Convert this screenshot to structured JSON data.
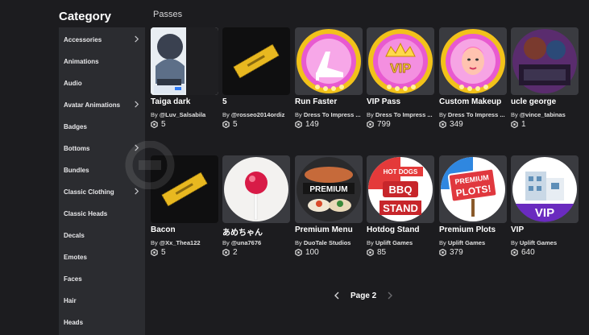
{
  "sidebar": {
    "title": "Category",
    "items": [
      {
        "label": "Accessories",
        "chevron": true
      },
      {
        "label": "Animations",
        "chevron": false
      },
      {
        "label": "Audio",
        "chevron": false
      },
      {
        "label": "Avatar Animations",
        "chevron": true
      },
      {
        "label": "Badges",
        "chevron": false
      },
      {
        "label": "Bottoms",
        "chevron": true
      },
      {
        "label": "Bundles",
        "chevron": false
      },
      {
        "label": "Classic Clothing",
        "chevron": true
      },
      {
        "label": "Classic Heads",
        "chevron": false
      },
      {
        "label": "Decals",
        "chevron": false
      },
      {
        "label": "Emotes",
        "chevron": false
      },
      {
        "label": "Faces",
        "chevron": false
      },
      {
        "label": "Hair",
        "chevron": false
      },
      {
        "label": "Heads",
        "chevron": false
      }
    ]
  },
  "section": {
    "label": "Passes"
  },
  "items": [
    {
      "name": "Taiga dark",
      "by": "By",
      "creator": "@Luv_Salsabila",
      "price": "5",
      "icon": "anime-character-image"
    },
    {
      "name": "5",
      "by": "By",
      "creator": "@rosseo2014ordiz",
      "price": "5",
      "icon": "yellow-ticket-image"
    },
    {
      "name": "Run Faster",
      "by": "By",
      "creator": "Dress To Impress ...",
      "price": "149",
      "icon": "high-heel-badge"
    },
    {
      "name": "VIP Pass",
      "by": "By",
      "creator": "Dress To Impress ...",
      "price": "799",
      "icon": "vip-crown-badge",
      "badge_text": "VIP"
    },
    {
      "name": "Custom Makeup",
      "by": "By",
      "creator": "Dress To Impress ...",
      "price": "349",
      "icon": "makeup-face-badge"
    },
    {
      "name": "ucle george",
      "by": "By",
      "creator": "@vince_tabinas",
      "price": "1",
      "icon": "photo-thumbnail"
    },
    {
      "name": "Bacon",
      "by": "By",
      "creator": "@Xx_Thea122",
      "price": "5",
      "icon": "yellow-ticket-image"
    },
    {
      "name": "あめちゃん",
      "by": "By",
      "creator": "@una7676",
      "price": "2",
      "icon": "lollipop-image"
    },
    {
      "name": "Premium Menu",
      "by": "By",
      "creator": "DuoTale Studios",
      "price": "100",
      "icon": "premium-food-image",
      "badge_text": "PREMIUM"
    },
    {
      "name": "Hotdog Stand",
      "by": "By",
      "creator": "Uplift Games",
      "price": "85",
      "icon": "hotdog-stand-badge",
      "badge_text": "HOT DOGS",
      "badge_text2": "BBQ",
      "badge_text3": "STAND"
    },
    {
      "name": "Premium Plots",
      "by": "By",
      "creator": "Uplift Games",
      "price": "379",
      "icon": "premium-plots-badge",
      "badge_text": "PREMIUM",
      "badge_text2": "PLOTS!"
    },
    {
      "name": "VIP",
      "by": "By",
      "creator": "Uplift Games",
      "price": "640",
      "icon": "vip-house-badge",
      "badge_text": "VIP"
    }
  ],
  "pagination": {
    "label": "Page 2"
  },
  "colors": {
    "background": "#1c1c1f",
    "sidebar": "#2b2c30",
    "text": "#ffffff"
  }
}
